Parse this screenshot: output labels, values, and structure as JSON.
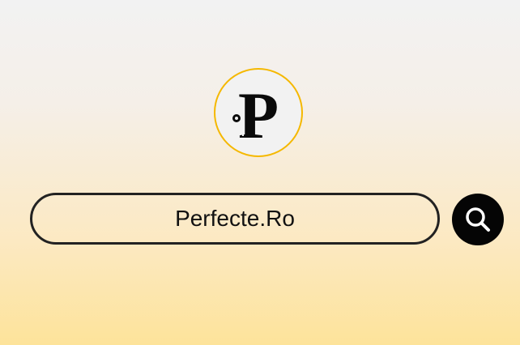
{
  "logo": {
    "icon": "perfecte-ro-logo-icon",
    "letter": "P",
    "ring_color": "#f5b800"
  },
  "search": {
    "value": "Perfecte.Ro",
    "border_color": "#222222"
  },
  "search_button": {
    "icon": "search-icon",
    "background": "#050505",
    "icon_color": "#ffffff"
  }
}
